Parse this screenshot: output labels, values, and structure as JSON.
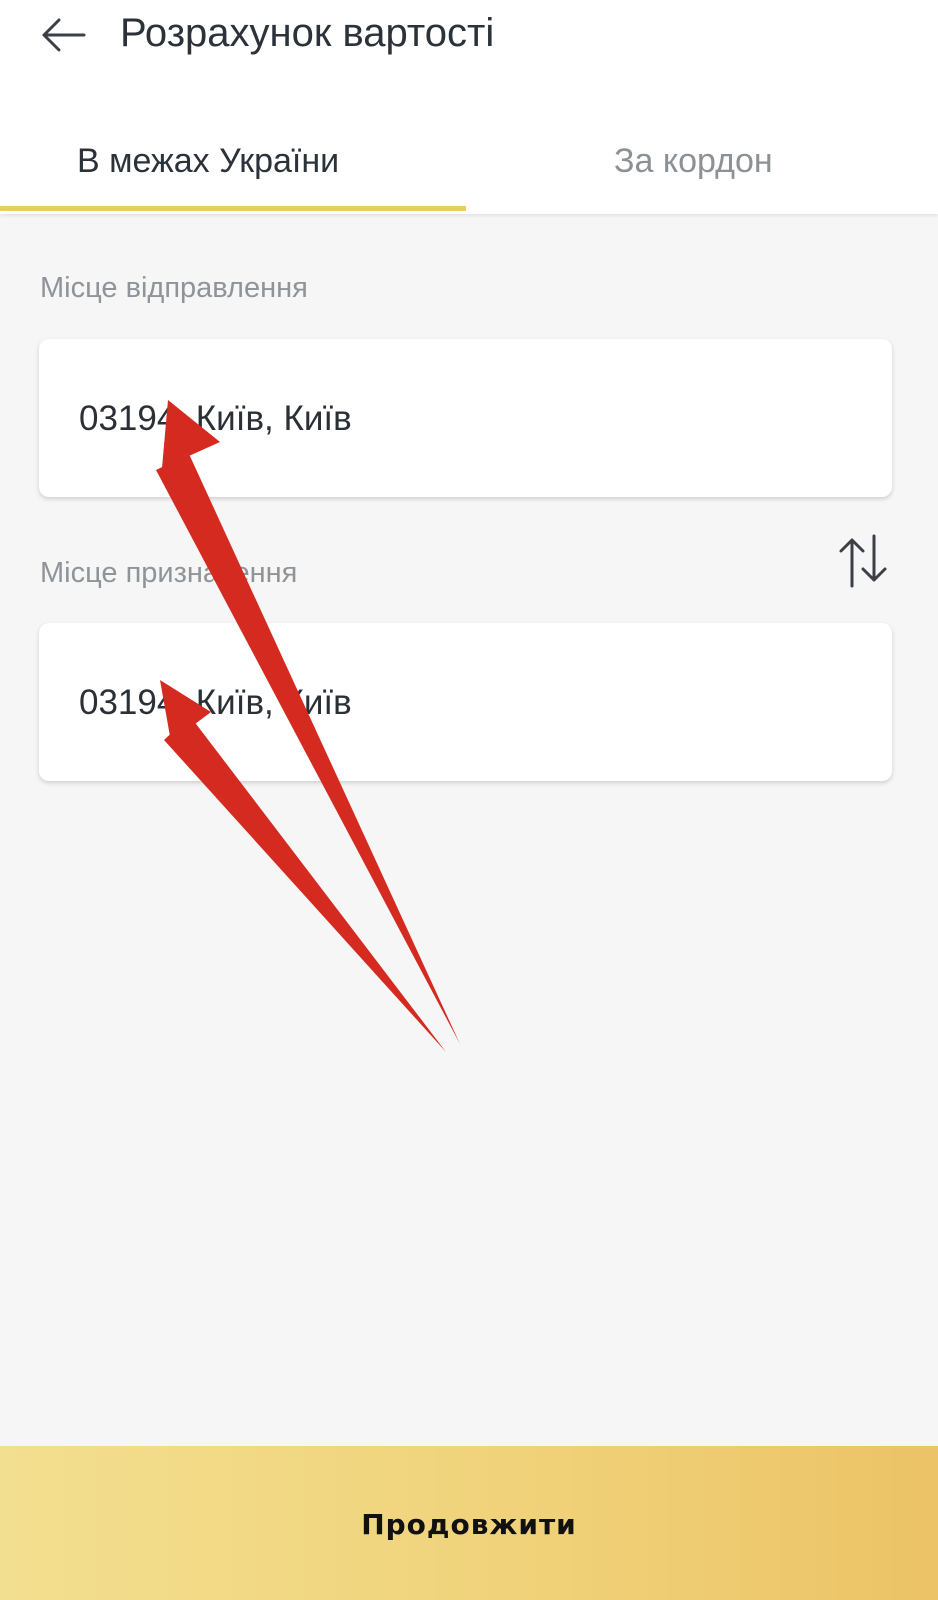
{
  "header": {
    "back_icon": "arrow-left-icon",
    "title": "Розрахунок вартості"
  },
  "tabs": [
    {
      "label": "В межах України",
      "active": true
    },
    {
      "label": "За кордон",
      "active": false
    }
  ],
  "form": {
    "departure": {
      "label": "Місце відправлення",
      "value": "03194, Київ, Київ"
    },
    "destination": {
      "label": "Місце призначення",
      "value": "03194, Київ, Київ"
    },
    "swap_icon": "swap-vertical-icon"
  },
  "footer": {
    "continue_label": "Продовжити"
  },
  "colors": {
    "accent": "#ebcb63",
    "button_gradient_start": "#f3df90",
    "button_gradient_end": "#ecc366",
    "annotation_arrow": "#d42a20",
    "background": "#f6f6f6"
  }
}
